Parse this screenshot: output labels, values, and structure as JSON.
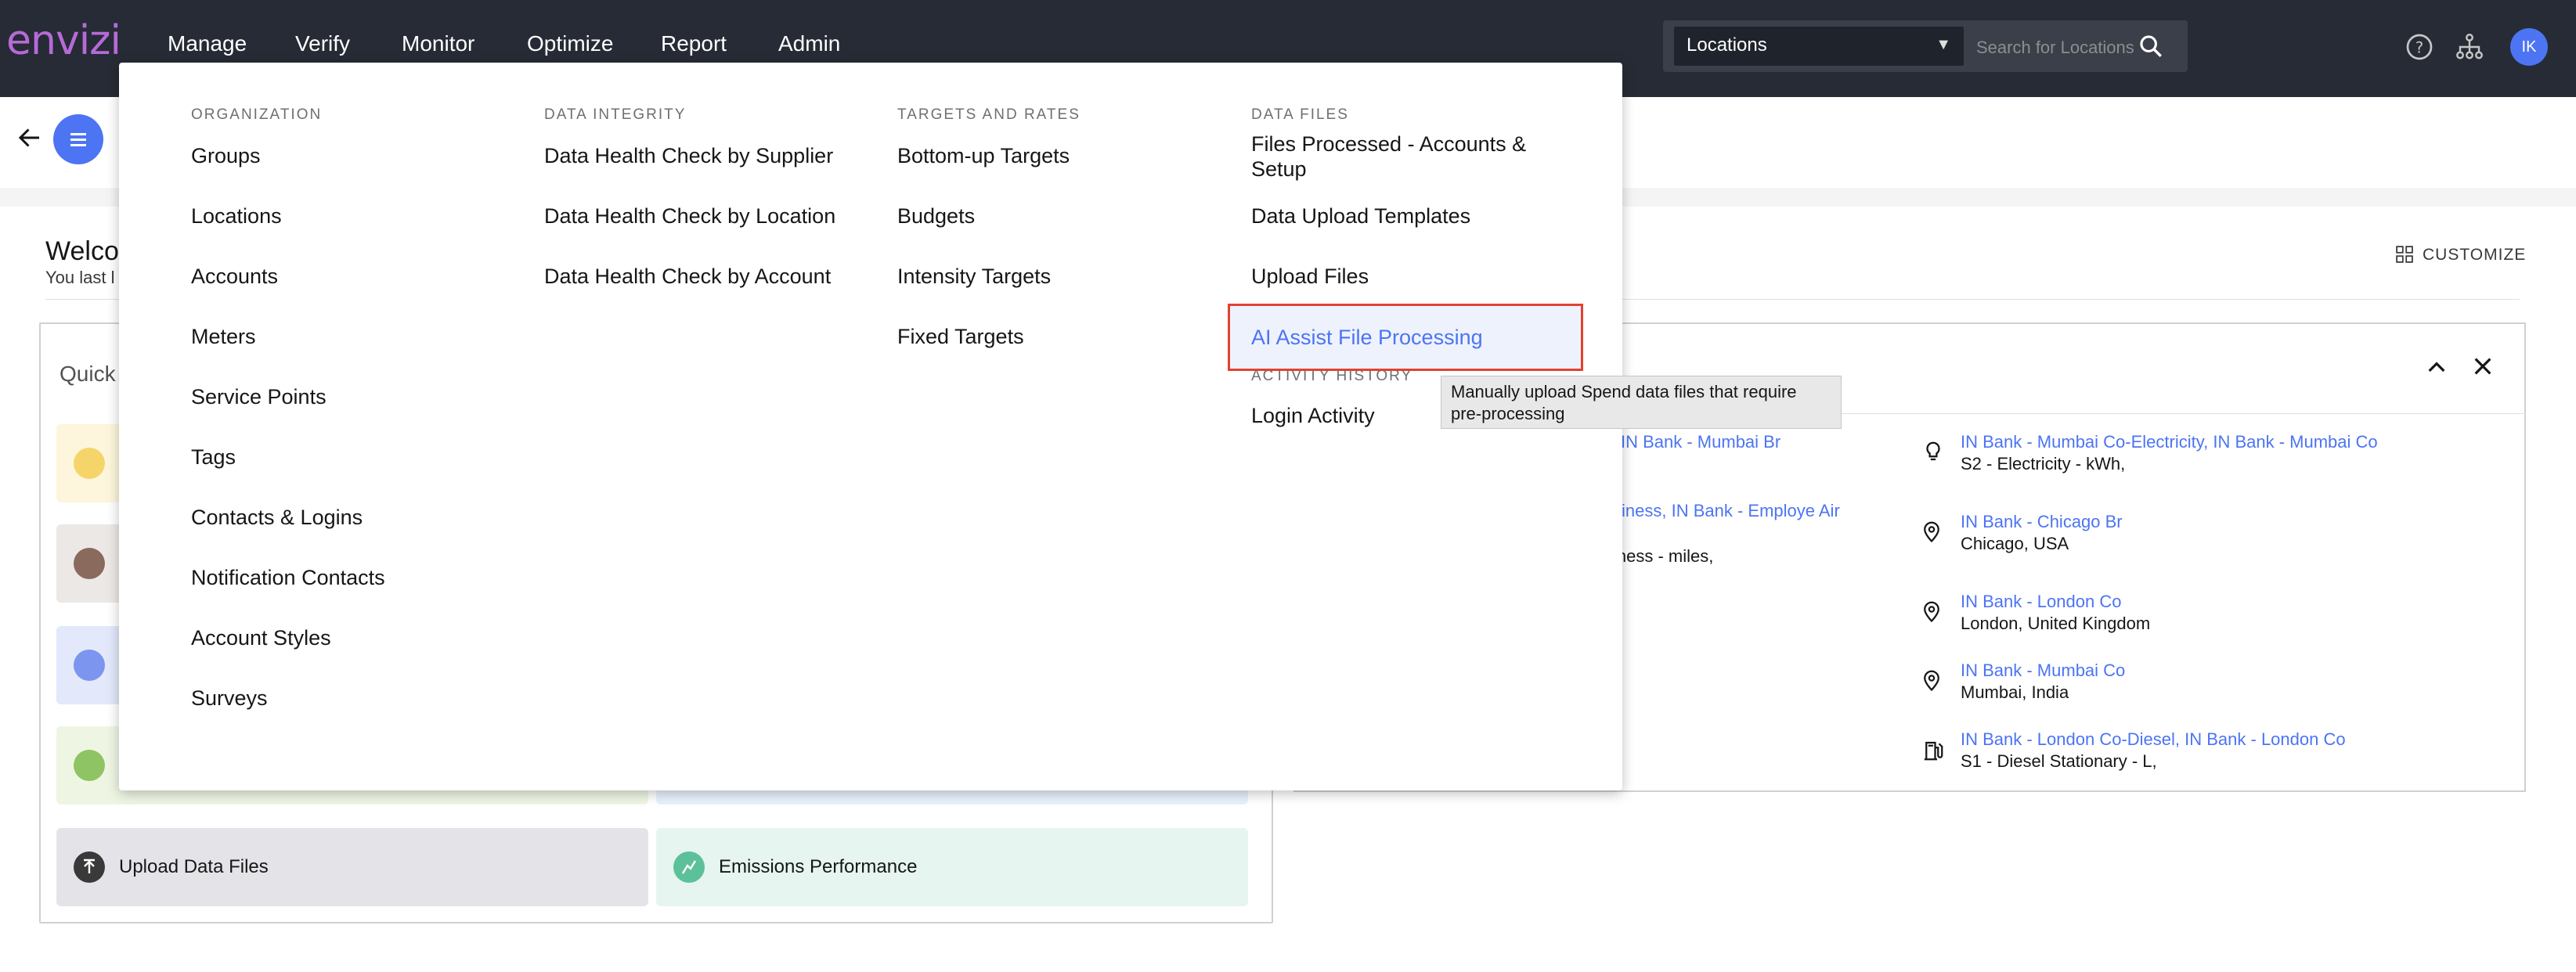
{
  "app": {
    "logo": "envizi"
  },
  "nav": {
    "items": [
      {
        "label": "Manage"
      },
      {
        "label": "Verify"
      },
      {
        "label": "Monitor"
      },
      {
        "label": "Optimize"
      },
      {
        "label": "Report"
      },
      {
        "label": "Admin"
      }
    ]
  },
  "location_search": {
    "selected": "Locations",
    "placeholder": "Search for Locations"
  },
  "user": {
    "initials": "IK"
  },
  "dashboard": {
    "welcome": "Welco",
    "last_login": "You last l",
    "customize": "CUSTOMIZE",
    "quick_links_title": "Quick l",
    "tiles": [
      {
        "label": "Upload Data Files",
        "color": "#e4e4e8"
      },
      {
        "label": "Emissions Performance",
        "color": "#e6f5ef"
      }
    ]
  },
  "recent": {
    "left": [
      {
        "title": "IN Bank - Mumbai Br"
      },
      {
        "title": "siness, IN Bank - Employe Air",
        "sub": "iness - miles,"
      }
    ],
    "right": [
      {
        "icon": "lightbulb-icon",
        "title": "IN Bank - Mumbai Co-Electricity, IN Bank - Mumbai Co",
        "sub": "S2 - Electricity - kWh,"
      },
      {
        "icon": "location-pin-icon",
        "title": "IN Bank - Chicago Br",
        "sub": "Chicago, USA"
      },
      {
        "icon": "location-pin-icon",
        "title": "IN Bank - London Co",
        "sub": "London, United Kingdom"
      },
      {
        "icon": "location-pin-icon",
        "title": "IN Bank - Mumbai Co",
        "sub": "Mumbai, India"
      },
      {
        "icon": "fuel-pump-icon",
        "title": "IN Bank - London Co-Diesel, IN Bank - London Co",
        "sub": "S1 - Diesel Stationary - L,"
      }
    ]
  },
  "mega_menu": {
    "organization": {
      "heading": "ORGANIZATION",
      "items": [
        "Groups",
        "Locations",
        "Accounts",
        "Meters",
        "Service Points",
        "Tags",
        "Contacts & Logins",
        "Notification Contacts",
        "Account Styles",
        "Surveys"
      ]
    },
    "data_integrity": {
      "heading": "DATA INTEGRITY",
      "items": [
        "Data Health Check by Supplier",
        "Data Health Check by Location",
        "Data Health Check by Account"
      ]
    },
    "targets": {
      "heading": "TARGETS AND RATES",
      "items": [
        "Bottom-up Targets",
        "Budgets",
        "Intensity Targets",
        "Fixed Targets"
      ]
    },
    "data_files": {
      "heading": "DATA FILES",
      "items": [
        "Files Processed - Accounts & Setup",
        "Data Upload Templates",
        "Upload Files",
        "AI Assist File Processing"
      ]
    },
    "activity": {
      "heading": "ACTIVITY HISTORY",
      "items": [
        "Login Activity"
      ]
    },
    "tooltip": "Manually upload Spend data files that require pre-processing"
  },
  "colors": {
    "accent": "#4c74f3",
    "topbar": "#262b35",
    "highlight_border": "#e3412f"
  }
}
